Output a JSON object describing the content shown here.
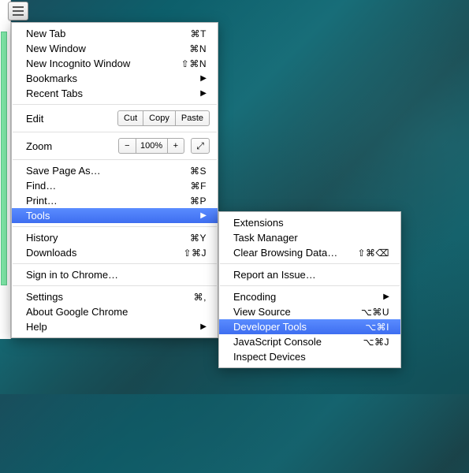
{
  "hamburger": {
    "name": "menu"
  },
  "main_menu": {
    "new_tab": {
      "label": "New Tab",
      "shortcut": "⌘T"
    },
    "new_window": {
      "label": "New Window",
      "shortcut": "⌘N"
    },
    "new_incognito": {
      "label": "New Incognito Window",
      "shortcut": "⇧⌘N"
    },
    "bookmarks": {
      "label": "Bookmarks"
    },
    "recent_tabs": {
      "label": "Recent Tabs"
    },
    "edit": {
      "label": "Edit",
      "cut": "Cut",
      "copy": "Copy",
      "paste": "Paste"
    },
    "zoom": {
      "label": "Zoom",
      "minus": "−",
      "value": "100%",
      "plus": "+"
    },
    "save_page": {
      "label": "Save Page As…",
      "shortcut": "⌘S"
    },
    "find": {
      "label": "Find…",
      "shortcut": "⌘F"
    },
    "print": {
      "label": "Print…",
      "shortcut": "⌘P"
    },
    "tools": {
      "label": "Tools"
    },
    "history": {
      "label": "History",
      "shortcut": "⌘Y"
    },
    "downloads": {
      "label": "Downloads",
      "shortcut": "⇧⌘J"
    },
    "signin": {
      "label": "Sign in to Chrome…"
    },
    "settings": {
      "label": "Settings",
      "shortcut": "⌘,"
    },
    "about": {
      "label": "About Google Chrome"
    },
    "help": {
      "label": "Help"
    }
  },
  "sub_menu": {
    "extensions": {
      "label": "Extensions"
    },
    "task_manager": {
      "label": "Task Manager"
    },
    "clear_browsing": {
      "label": "Clear Browsing Data…",
      "shortcut": "⇧⌘⌫"
    },
    "report_issue": {
      "label": "Report an Issue…"
    },
    "encoding": {
      "label": "Encoding"
    },
    "view_source": {
      "label": "View Source",
      "shortcut": "⌥⌘U"
    },
    "developer_tools": {
      "label": "Developer Tools",
      "shortcut": "⌥⌘I"
    },
    "js_console": {
      "label": "JavaScript Console",
      "shortcut": "⌥⌘J"
    },
    "inspect_devices": {
      "label": "Inspect Devices"
    }
  }
}
